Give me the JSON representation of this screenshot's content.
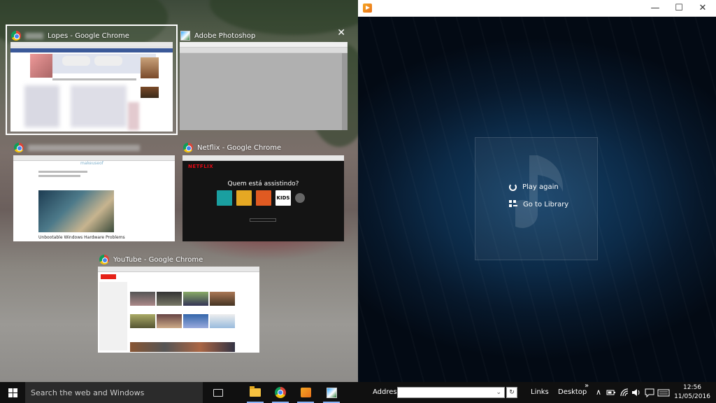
{
  "snap_assist": {
    "windows": [
      {
        "title_suffix": "Lopes - Google Chrome",
        "app": "chrome",
        "selected": true
      },
      {
        "title": "Adobe Photoshop",
        "app": "photoshop"
      },
      {
        "title_blurred": true,
        "app": "chrome",
        "caption": "Unbootable Windows Hardware Problems",
        "site_logo": "makeuseof"
      },
      {
        "title": "Netflix - Google Chrome",
        "app": "chrome",
        "netflix": {
          "logo": "NETFLIX",
          "question": "Quem está assistindo?",
          "kids": "KIDS"
        }
      },
      {
        "title": "YouTube - Google Chrome",
        "app": "chrome"
      }
    ],
    "close_glyph": "✕"
  },
  "media_app": {
    "controls": {
      "minimize": "—",
      "maximize": "☐",
      "close": "✕"
    },
    "menu": [
      {
        "label": "Play again",
        "icon": "replay-icon"
      },
      {
        "label": "Go to Library",
        "icon": "library-icon"
      }
    ],
    "colors": {
      "accent": "#14426a"
    }
  },
  "taskbar": {
    "search_placeholder": "Search the web and Windows",
    "address_label": "Address",
    "address_dropdown": "⌄",
    "address_go": "↻",
    "links": "Links",
    "desktop": "Desktop",
    "chevron": "»",
    "tray_up": "∧",
    "time": "12:56",
    "date": "11/05/2016"
  }
}
